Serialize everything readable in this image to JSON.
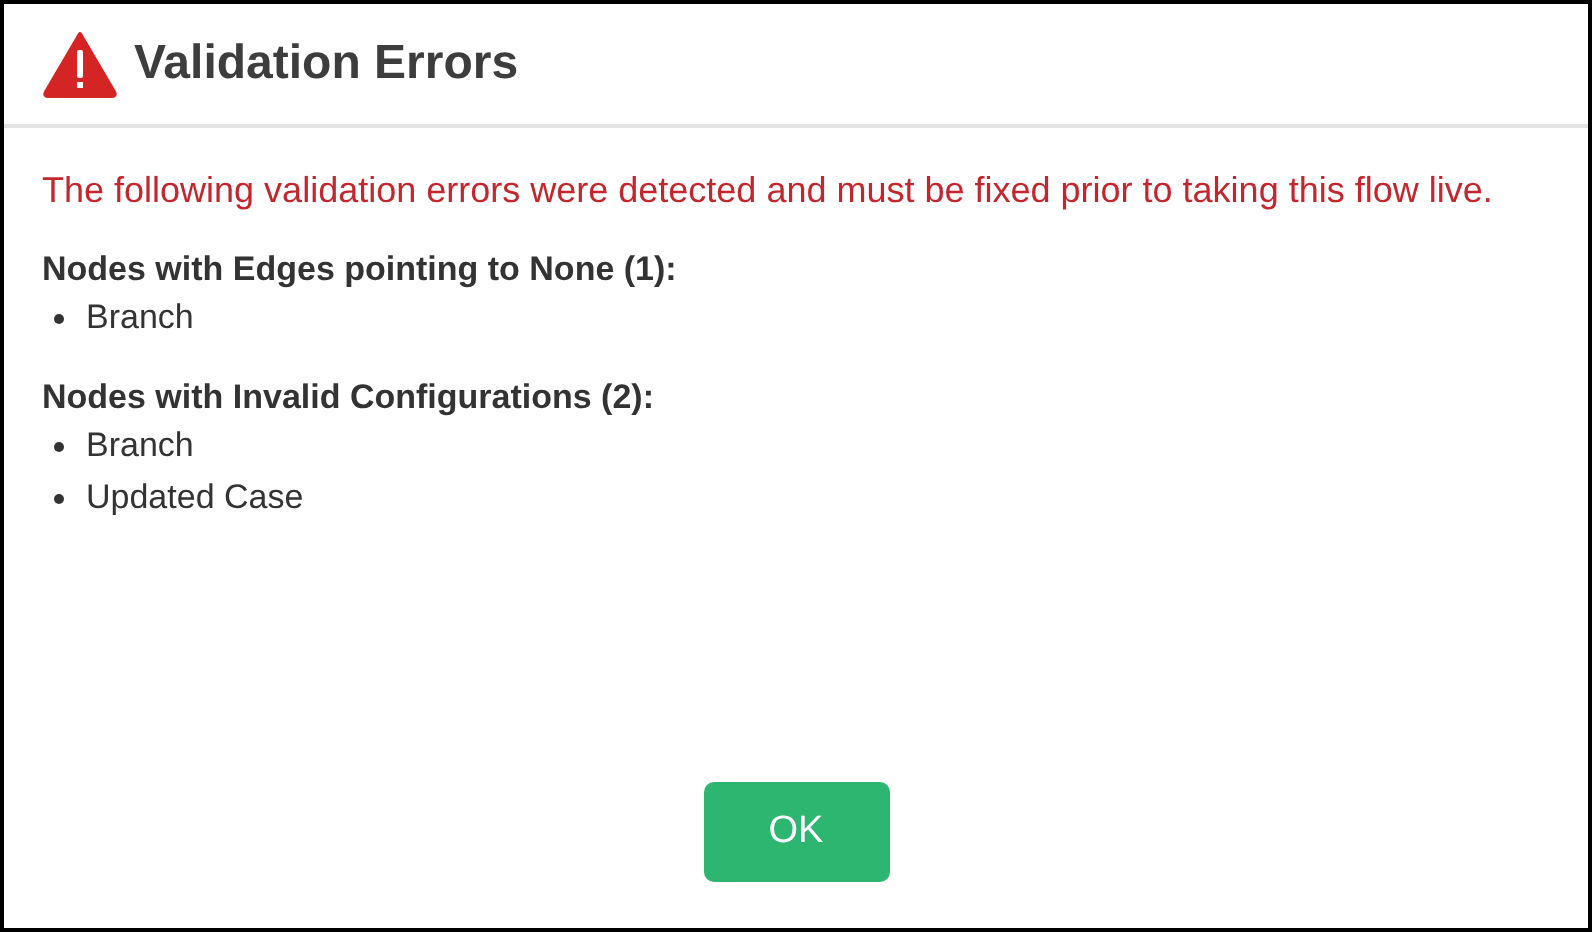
{
  "dialog": {
    "title": "Validation Errors",
    "message": "The following validation errors were detected and must be fixed prior to taking this flow live.",
    "sections": [
      {
        "heading": "Nodes with Edges pointing to None (1):",
        "items": [
          "Branch"
        ]
      },
      {
        "heading": "Nodes with Invalid Configurations (2):",
        "items": [
          "Branch",
          "Updated Case"
        ]
      }
    ],
    "buttons": [
      "OK"
    ]
  }
}
